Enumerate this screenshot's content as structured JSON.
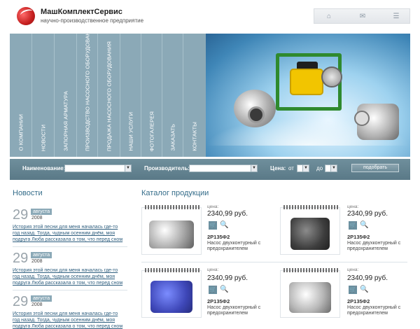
{
  "header": {
    "brand": "МашКомплектСервис",
    "tagline": "научно-производственное предприятие",
    "icons": [
      "home-icon",
      "mail-icon",
      "sitemap-icon"
    ]
  },
  "nav": {
    "items": [
      "О КОМПАНИИ",
      "НОВОСТИ",
      "ЗАПОРНАЯ АРМАТУРА",
      "ПРОИЗВОДСТВО НАСОСНОГО ОБОРУДОВАНИЯ",
      "ПРОДАЖА НАСОСНОГО ОБОРУДОВАНИЯ",
      "НАШИ УСЛУГИ",
      "ФОТОГАЛЕРЕЯ",
      "ЗАКАЗАТЬ",
      "КОНТАКТЫ"
    ]
  },
  "search": {
    "name_label": "Наименование:",
    "producer_label": "Производитель:",
    "price_label": "Цена:",
    "from_label": "от",
    "to_label": "до",
    "find_button": "подобрать"
  },
  "news": {
    "title": "Новости",
    "items": [
      {
        "day": "29",
        "month": "августа",
        "year": "2008",
        "text": "История этой песни для меня началась где-то год назад. Тогда, чудным осенним днём, моя подруга Люба рассказала о том, что перед сном"
      },
      {
        "day": "29",
        "month": "августа",
        "year": "2008",
        "text": "История этой песни для меня началась где-то год назад. Тогда, чудным осенним днём, моя подруга Люба рассказала о том, что перед сном"
      },
      {
        "day": "29",
        "month": "августа",
        "year": "2008",
        "text": "История этой песни для меня началась где-то год назад. Тогда, чудным осенним днём, моя подруга Люба рассказала о том, что перед сном"
      }
    ]
  },
  "catalog": {
    "title": "Каталог продукции",
    "items": [
      {
        "price_label": "цена:",
        "price": "2340,99 руб.",
        "code": "2Р135Ф2",
        "desc": "Насос двухконтурный с предохранителем"
      },
      {
        "price_label": "цена:",
        "price": "2340,99 руб.",
        "code": "2Р135Ф2",
        "desc": "Насос двухконтурный с предохранителем"
      },
      {
        "price_label": "цена:",
        "price": "2340,99 руб.",
        "code": "2Р135Ф2",
        "desc": "Насос двухконтурный с предохранителем"
      },
      {
        "price_label": "цена:",
        "price": "2340,99 руб.",
        "code": "2Р135Ф2",
        "desc": "Насос двухконтурный с предохранителем"
      }
    ]
  },
  "colors": {
    "accent": "#356d8a",
    "nav_bg": "#8ba9b7",
    "search_bg": "#5a7987"
  }
}
